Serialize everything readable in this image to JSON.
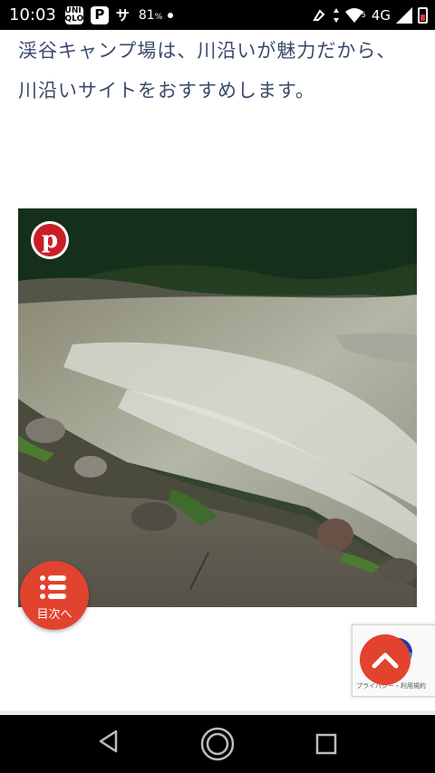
{
  "status_bar": {
    "time": "10:03",
    "apps": [
      "UNI QLO",
      "P",
      "サ"
    ],
    "battery_text": "81",
    "battery_unit": "%",
    "network": "4G",
    "signal_badge": "5"
  },
  "article": {
    "line1": "渓谷キャンプ場は、川沿いが魅力だから、",
    "line2": "川沿いサイトをおすすめします。"
  },
  "pinterest": {
    "icon_glyph": "p"
  },
  "toc": {
    "label": "目次へ"
  },
  "recaptcha": {
    "links": "プライバシー・利用規約"
  },
  "colors": {
    "accent": "#e2432f",
    "text": "#3b4a6b",
    "pinterest": "#cb1f27"
  }
}
